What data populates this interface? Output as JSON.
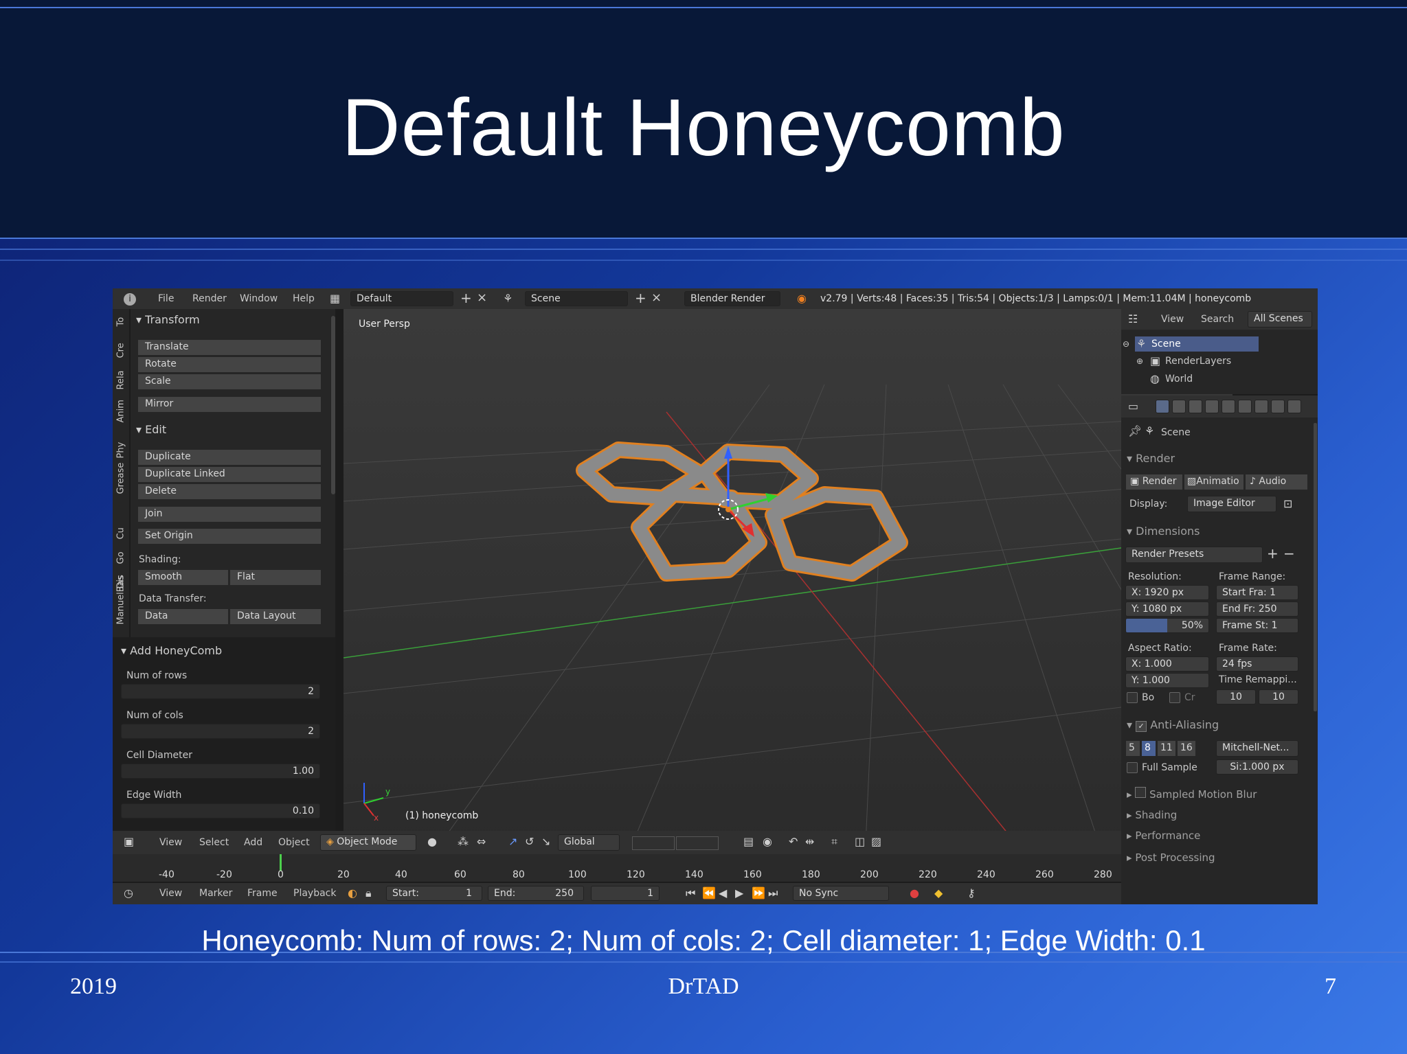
{
  "slide": {
    "title": "Default Honeycomb",
    "caption": "Honeycomb: Num of rows: 2; Num of cols: 2; Cell diameter: 1; Edge Width: 0.1",
    "footer_left": "2019",
    "footer_center": "DrTAD",
    "footer_right": "7"
  },
  "topbar": {
    "menus": [
      "File",
      "Render",
      "Window",
      "Help"
    ],
    "layout": "Default",
    "scene": "Scene",
    "engine": "Blender Render",
    "stats": "v2.79 | Verts:48 | Faces:35 | Tris:54 | Objects:1/3 | Lamps:0/1 | Mem:11.04M | honeycomb"
  },
  "tool_tabs": [
    "To",
    "Cre",
    "Rela",
    "Anim",
    "Phy",
    "Grease",
    "Cu",
    "Go",
    "Dis",
    "ManuelBas"
  ],
  "toolshelf": {
    "transform_header": "Transform",
    "transform_buttons": [
      "Translate",
      "Rotate",
      "Scale"
    ],
    "mirror": "Mirror",
    "edit_header": "Edit",
    "edit_buttons": [
      "Duplicate",
      "Duplicate Linked",
      "Delete"
    ],
    "join": "Join",
    "set_origin": "Set Origin",
    "shading_label": "Shading:",
    "smooth": "Smooth",
    "flat": "Flat",
    "data_transfer_label": "Data Transfer:",
    "data": "Data",
    "data_layout": "Data Layout"
  },
  "operator_panel": {
    "header": "Add HoneyComb",
    "fields": [
      {
        "label": "Num of rows",
        "value": "2"
      },
      {
        "label": "Num of cols",
        "value": "2"
      },
      {
        "label": "Cell Diameter",
        "value": "1.00"
      },
      {
        "label": "Edge Width",
        "value": "0.10"
      }
    ]
  },
  "viewport": {
    "view_label": "User Persp",
    "object_label": "(1) honeycomb",
    "axis_y": "y",
    "axis_x": "x"
  },
  "viewport_header": {
    "menus": [
      "View",
      "Select",
      "Add",
      "Object"
    ],
    "mode": "Object Mode",
    "orientation": "Global"
  },
  "timeline": {
    "ticks": [
      "-40",
      "-20",
      "0",
      "20",
      "40",
      "60",
      "80",
      "100",
      "120",
      "140",
      "160",
      "180",
      "200",
      "220",
      "240",
      "260",
      "280"
    ],
    "menus": [
      "View",
      "Marker",
      "Frame",
      "Playback"
    ],
    "start_label": "Start:",
    "start_value": "1",
    "end_label": "End:",
    "end_value": "250",
    "current_frame": "1",
    "sync": "No Sync"
  },
  "outliner": {
    "menus": [
      "View",
      "Search",
      "All Scenes"
    ],
    "items": [
      "Scene",
      "RenderLayers",
      "World"
    ]
  },
  "properties": {
    "context": "Scene",
    "render_header": "Render",
    "render_buttons": [
      "Render",
      "Animatio",
      "Audio"
    ],
    "display_label": "Display:",
    "display_value": "Image Editor",
    "dimensions_header": "Dimensions",
    "render_presets": "Render Presets",
    "resolution_label": "Resolution:",
    "res_x": "X:  1920 px",
    "res_y": "Y:  1080 px",
    "res_pct": "50%",
    "frame_range_label": "Frame Range:",
    "start_fra": "Start Fra:  1",
    "end_fr": "End Fr:  250",
    "frame_st": "Frame St:  1",
    "aspect_label": "Aspect Ratio:",
    "aspect_x": "X:     1.000",
    "aspect_y": "Y:     1.000",
    "frame_rate_label": "Frame Rate:",
    "fps": "24 fps",
    "time_remap": "Time Remappi...",
    "remap_old": "10",
    "remap_new": "10",
    "bo": "Bo",
    "cr": "Cr",
    "aa_header": "Anti-Aliasing",
    "aa_samples": [
      "5",
      "8",
      "11",
      "16"
    ],
    "filter": "Mitchell-Net...",
    "full_sample": "Full Sample",
    "filter_size": "Si:1.000 px",
    "collapsed": [
      "Sampled Motion Blur",
      "Shading",
      "Performance",
      "Post Processing"
    ]
  }
}
